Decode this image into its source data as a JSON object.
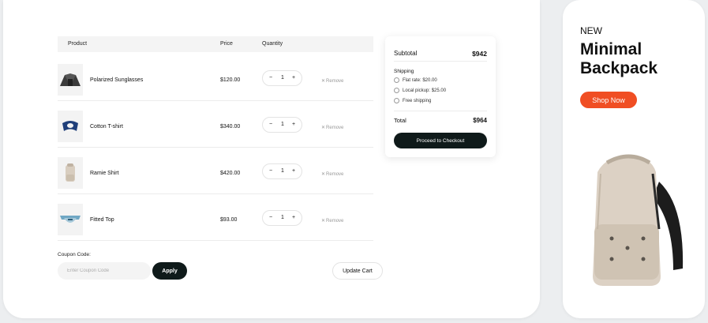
{
  "cart": {
    "columns": {
      "product": "Product",
      "price": "Price",
      "quantity": "Quantity"
    },
    "items": [
      {
        "name": "Polarized Sunglasses",
        "price": "$120.00",
        "qty": "1",
        "remove": "Remove",
        "icon": "tent-product-image"
      },
      {
        "name": "Cotton T-shirt",
        "price": "$340.00",
        "qty": "1",
        "remove": "Remove",
        "icon": "neck-pillow-product-image"
      },
      {
        "name": "Ramie Shirt",
        "price": "$420.00",
        "qty": "1",
        "remove": "Remove",
        "icon": "backpack-product-image"
      },
      {
        "name": "Fitted Top",
        "price": "$93.00",
        "qty": "1",
        "remove": "Remove",
        "icon": "waist-bag-product-image"
      }
    ],
    "qty_minus": "−",
    "qty_plus": "+",
    "remove_x": "✕",
    "coupon_label": "Coupon Code:",
    "coupon_placeholder": "Enter Coupon Code",
    "apply_label": "Apply",
    "update_label": "Update Cart"
  },
  "summary": {
    "subtotal_label": "Subtotal",
    "subtotal_value": "$942",
    "shipping_label": "Shipping",
    "options": [
      "Flat rate: $20.00",
      "Local pickup: $25.00",
      "Free shipping"
    ],
    "total_label": "Total",
    "total_value": "$964",
    "checkout_label": "Proceed to Checkout"
  },
  "promo": {
    "tag": "NEW",
    "title": "Minimal Backpack",
    "button_label": "Shop Now",
    "accent_color": "#f04e23"
  }
}
